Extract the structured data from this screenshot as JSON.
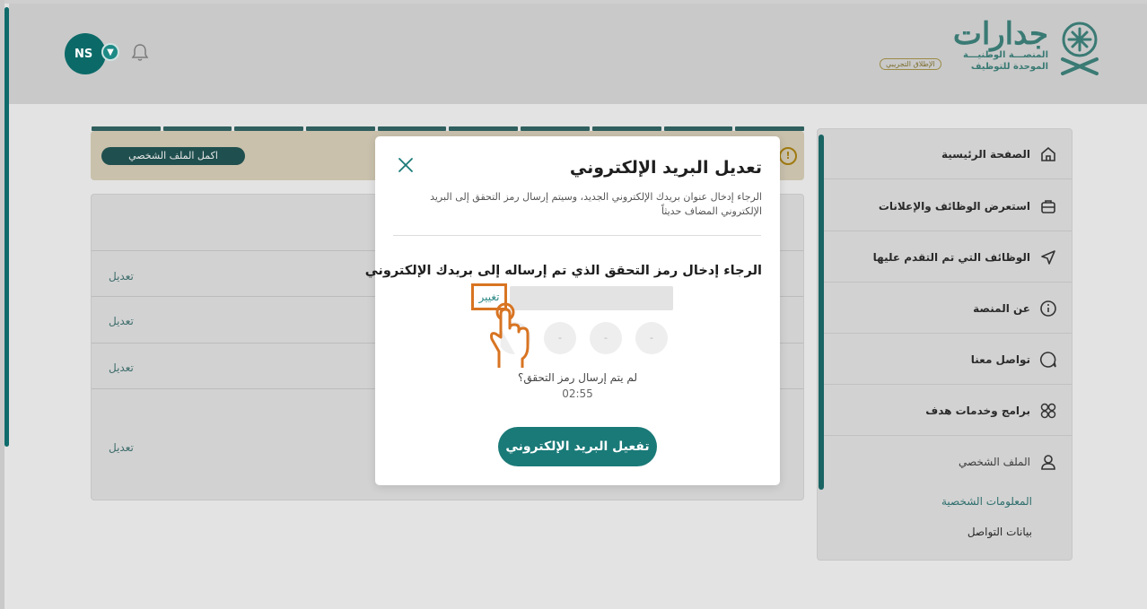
{
  "header": {
    "avatar_initials": "NS",
    "logo": {
      "name": "جدارات",
      "subtitle_line1": "المنصـــة الوطنيـــة",
      "subtitle_line2": "الموحدة للتوظيف",
      "badge": "الإطلاق التجريبي"
    }
  },
  "banner": {
    "button_label": "اكمل الملف الشخصي",
    "warning_symbol": "!"
  },
  "card": {
    "edit_labels": [
      "تعديل",
      "تعديل",
      "تعديل",
      "تعديل"
    ]
  },
  "sidebar": {
    "items": [
      {
        "label": "الصفحة الرئيسية",
        "icon": "home-icon"
      },
      {
        "label": "استعرض الوظائف والإعلانات",
        "icon": "briefcase-icon"
      },
      {
        "label": "الوظائف التي تم التقدم عليها",
        "icon": "send-icon"
      },
      {
        "label": "عن المنصة",
        "icon": "info-icon"
      },
      {
        "label": "تواصل معنا",
        "icon": "chat-icon"
      },
      {
        "label": "برامج وخدمات هدف",
        "icon": "grid-icon"
      },
      {
        "label": "الملف الشخصي",
        "icon": "user-icon"
      }
    ],
    "sub_items": [
      "المعلومات الشخصية",
      "بيانات التواصل"
    ]
  },
  "modal": {
    "title": "تعديل البريد الإلكتروني",
    "description": "الرجاء إدخال عنوان بريدك الإلكتروني الجديد، وسيتم إرسال رمز التحقق إلى البريد الإلكتروني المضاف حديثاً",
    "prompt": "الرجاء إدخال رمز التحقق الذي تم إرساله إلى بريدك الإلكتروني",
    "change_label": "تغيير",
    "otp_placeholders": [
      "-",
      "-",
      "-",
      "-"
    ],
    "resend_question": "لم يتم إرسال رمز التحقق؟",
    "timer": "02:55",
    "activate_label": "تفعيل البريد الإلكتروني"
  },
  "colors": {
    "brand": "#1a7a78",
    "highlight": "#d87422",
    "overlay": "#c9c9c9"
  }
}
